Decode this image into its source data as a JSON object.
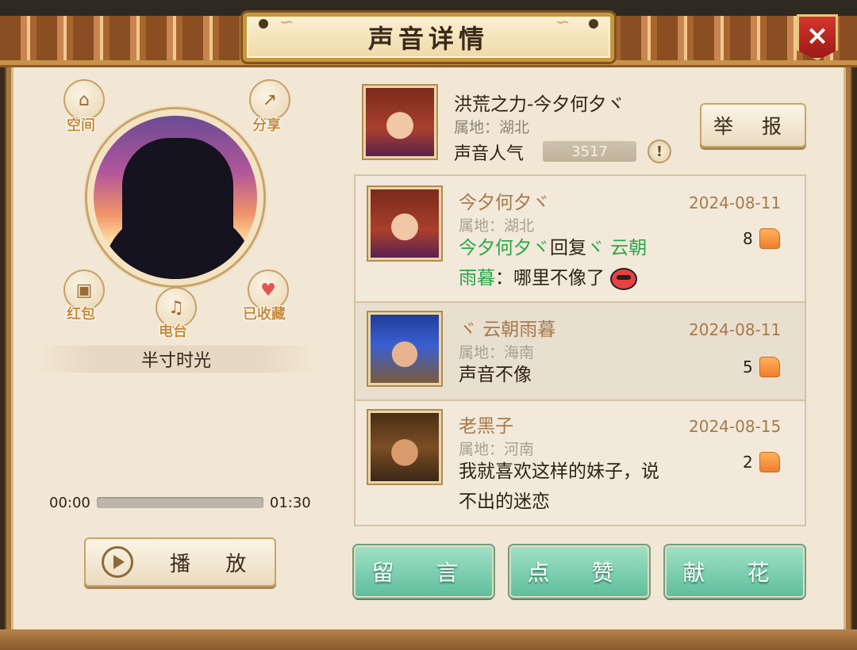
{
  "dialog": {
    "title": "声音详情",
    "close_icon": "×"
  },
  "left": {
    "icons": {
      "space": "空间",
      "share": "分享",
      "red_packet": "红包",
      "radio": "电台",
      "favorited": "已收藏"
    },
    "song_title": "半寸时光",
    "player": {
      "current_time": "00:00",
      "total_time": "01:30",
      "progress": 0,
      "play_label": "播 放"
    }
  },
  "owner": {
    "name": "洪荒之力-今夕何夕ヾ",
    "region": "属地：湖北",
    "popularity_label": "声音人气",
    "popularity_value": "3517",
    "report_label": "举 报"
  },
  "comments": [
    {
      "name": "今夕何夕ヾ",
      "region": "属地：湖北",
      "date": "2024-08-11",
      "likes": "8",
      "text_green1": "今夕何夕ヾ",
      "text_plain1": "回复",
      "text_green2": "ヾ 云朝",
      "text_green3": "雨暮",
      "text_plain2": "：哪里不像了"
    },
    {
      "name": "ヾ 云朝雨暮",
      "region": "属地：海南",
      "date": "2024-08-11",
      "likes": "5",
      "text": "声音不像"
    },
    {
      "name": "老黑子",
      "region": "属地：河南",
      "date": "2024-08-15",
      "likes": "2",
      "text_line1": "我就喜欢这样的妹子，说",
      "text_line2": "不出的迷恋"
    }
  ],
  "actions": {
    "message": "留 言",
    "like": "点 赞",
    "flower": "献 花"
  },
  "colors": {
    "accent_green": "#2aa64a",
    "name_brown": "#a57a4c",
    "button_green": "#7fd2b2",
    "close_red": "#c42a22"
  }
}
